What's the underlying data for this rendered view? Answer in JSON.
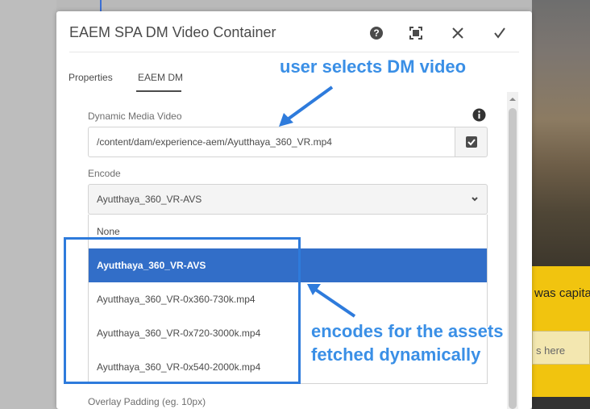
{
  "background": {
    "yellow_text": "was capita",
    "input_text": "s here"
  },
  "dialog": {
    "title": "EAEM SPA DM Video Container",
    "tabs": [
      {
        "label": "Properties"
      },
      {
        "label": "EAEM DM"
      }
    ],
    "fields": {
      "dm_video_label": "Dynamic Media Video",
      "dm_video_value": "/content/dam/experience-aem/Ayutthaya_360_VR.mp4",
      "encode_label": "Encode",
      "encode_selected": "Ayutthaya_360_VR-AVS",
      "encode_options": [
        "None",
        "Ayutthaya_360_VR-AVS",
        "Ayutthaya_360_VR-0x360-730k.mp4",
        "Ayutthaya_360_VR-0x720-3000k.mp4",
        "Ayutthaya_360_VR-0x540-2000k.mp4"
      ],
      "overlay_padding_label": "Overlay Padding (eg. 10px)"
    }
  },
  "annotations": {
    "top": "user selects DM video",
    "bottom_line1": "encodes for the assets",
    "bottom_line2": "fetched dynamically"
  },
  "colors": {
    "accent": "#326ec8",
    "annotation": "#3a8fe6",
    "yellow": "#f1c40f"
  }
}
